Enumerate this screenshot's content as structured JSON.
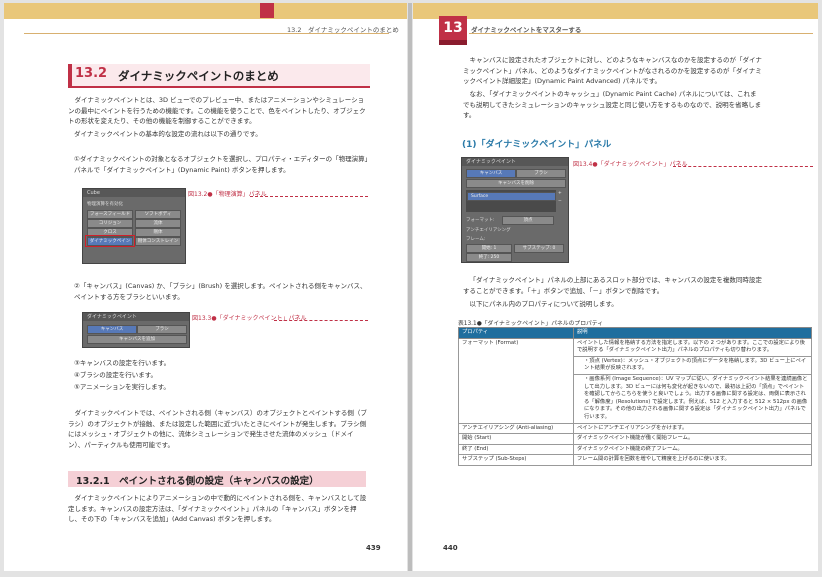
{
  "left_page": {
    "running_header": "13.2　ダイナミックペイントのまとめ",
    "heading_number": "13.2",
    "heading_title": "ダイナミックペイントのまとめ",
    "intro": "ダイナミックペイントとは、3D ビューでのプレビュー中、またはアニメーションやシミュレーションの最中にペイントを行うための機能です。この機能を使うことで、色をペイントしたり、オブジェクトの形状を変えたり、その他の機能を制御することができます。",
    "intro2": "ダイナミックペイントの基本的な設定の流れは以下の通りです。",
    "step1": "①ダイナミックペイントの対象となるオブジェクトを選択し、プロパティ・エディターの「物理演算」パネルで「ダイナミックペイント」(Dynamic Paint) ボタンを押します。",
    "fig1_caption": "図13.2●「物理演算」パネル",
    "fig1": {
      "title": "Cube",
      "section": "物理演算を有効化",
      "buttons": [
        "フォースフィールド",
        "コリジョン",
        "クロス",
        "ダイナミックペイント",
        "ソフトボディ",
        "流体",
        "剛体",
        "剛体コンストレイント"
      ]
    },
    "step2": "②「キャンバス」(Canvas) か、「ブラシ」(Brush) を選択します。ペイントされる側をキャンバス、ペイントする方をブラシといいます。",
    "fig2_caption": "図13.3●「ダイナミックペイント」パネル",
    "fig2": {
      "title": "ダイナミックペイント",
      "tab_canvas": "キャンバス",
      "tab_brush": "ブラシ",
      "add_button": "キャンバスを追加"
    },
    "step3": "③キャンバスの設定を行います。",
    "step4": "④ブラシの設定を行います。",
    "step5": "⑤アニメーションを実行します。",
    "para2": "ダイナミックペイントでは、ペイントされる側（キャンバス）のオブジェクトとペイントする側（ブラシ）のオブジェクトが接触、または設定した範囲に近づいたときにペイントが発生します。ブラシ側にはメッシュ・オブジェクトの他に、流体シミュレーションで発生させた流体のメッシュ（ドメイン）、パーティクルも使用可能です。",
    "sub_heading": "13.2.1　ペイントされる側の設定（キャンバスの設定）",
    "para3": "ダイナミックペイントによりアニメーションの中で動的にペイントされる側を、キャンバスとして設定します。キャンバスの設定方法は、「ダイナミックペイント」パネルの「キャンバス」ボタンを押し、その下の「キャンバスを追加」(Add Canvas) ボタンを押します。",
    "page_number": "439"
  },
  "right_page": {
    "chapter_number": "13",
    "running_header": "ダイナミックペイントをマスターする",
    "para1": "キャンバスに設定されたオブジェクトに対し、どのようなキャンバスなのかを設定するのが「ダイナミックペイント」パネル、どのようなダイナミックペイントがなされるのかを設定するのが「ダイナミックペイント詳細設定」(Dynamic Paint Advanced) パネルです。",
    "para2": "なお、「ダイナミックペイントのキャッシュ」(Dynamic Paint Cache) パネルについては、これまでも説明してきたシミュレーションのキャッシュ設定と同じ使い方をするものなので、説明を省略します。",
    "h3": "(1)「ダイナミックペイント」パネル",
    "fig_caption": "図13.4●「ダイナミックペイント」パネル",
    "fig": {
      "title": "ダイナミックペイント",
      "tab_canvas": "キャンバス",
      "tab_brush": "ブラシ",
      "remove_button": "キャンバスを削除",
      "slot": "Surface",
      "format_label": "フォーマット:",
      "format_value": "頂点",
      "antialias": "アンチエイリアシング",
      "frame_label": "フレーム:",
      "start": "開始: 1",
      "end": "終了: 250",
      "substeps": "サブステップ: 0"
    },
    "para3": "「ダイナミックペイント」パネルの上部にあるスロット部分では、キャンバスの設定を複数同時設定することができます。「＋」ボタンで追加、「－」ボタンで削除です。",
    "para4": "以下にパネル内のプロパティについて説明します。",
    "table_caption": "表13.1●「ダイナミックペイント」パネルのプロパティ",
    "table_headers": [
      "プロパティ",
      "説明"
    ],
    "table_rows": [
      {
        "prop": "フォーマット (Format)",
        "desc": "ペイントした情報を格納する方法を指定します。以下の 2 つがあります。ここでの設定により後で説明する「ダイナミックペイント出力」パネルのプロパティも切り替わります。"
      },
      {
        "prop": "",
        "desc": "・頂点 (Vertex)：メッシュ・オブジェクトの頂点にデータを格納します。3D ビュー上にペイント結果が反映されます。"
      },
      {
        "prop": "",
        "desc": "・画像系列 (Image Sequence)：UV マップに従い、ダイナミックペイント結果を連続画像として出力します。3D ビューには何も変化が起きないので、最初は上記の「頂点」でペイントを確認してからこちらを使うと良いでしょう。出力する画像に関する設定は、両側に表示される「解像度」(Resolutions) で設定します。例えば、512 と入力すると 512 × 512px の画像になります。その他の出力される画像に関する設定は「ダイナミックペイント出力」パネルで行います。"
      },
      {
        "prop": "アンチエイリアシング (Anti-aliasing)",
        "desc": "ペイントにアンチエイリアシングをかけます。"
      },
      {
        "prop": "開始 (Start)",
        "desc": "ダイナミックペイント機能が働く開始フレーム。"
      },
      {
        "prop": "終了 (End)",
        "desc": "ダイナミックペイント機能の終了フレーム。"
      },
      {
        "prop": "サブステップ (Sub-Steps)",
        "desc": "フレーム間の計算を回数を増やして精度を上げるのに使います。"
      }
    ],
    "page_number": "440"
  }
}
